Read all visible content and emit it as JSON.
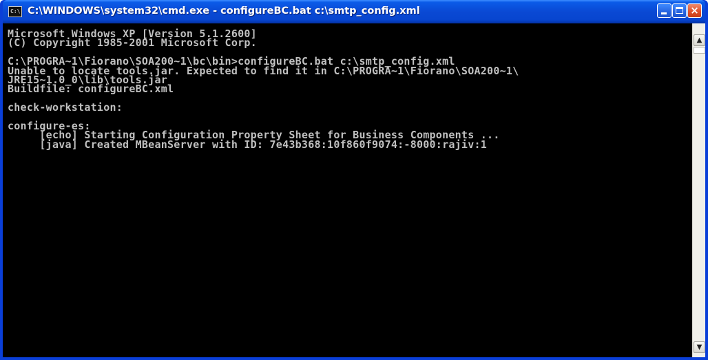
{
  "window": {
    "title": "C:\\WINDOWS\\system32\\cmd.exe - configureBC.bat c:\\smtp_config.xml",
    "icon_label": "C:\\",
    "icon": "cmd-console-icon"
  },
  "titlebar_buttons": {
    "minimize": "minimize-icon",
    "maximize": "maximize-icon",
    "close": "close-icon",
    "close_glyph": "×"
  },
  "colors": {
    "console_background": "#000000",
    "console_text": "#c0c0c0",
    "titlebar": "#0a49d4",
    "close_button": "#e0512b"
  },
  "console": {
    "lines": [
      "Microsoft Windows XP [Version 5.1.2600]",
      "(C) Copyright 1985-2001 Microsoft Corp.",
      "",
      "C:\\PROGRA~1\\Fiorano\\SOA200~1\\bc\\bin>configureBC.bat c:\\smtp_config.xml",
      "Unable to locate tools.jar. Expected to find it in C:\\PROGRA~1\\Fiorano\\SOA200~1\\",
      "JRE15~1.0_0\\lib\\tools.jar",
      "Buildfile: configureBC.xml",
      "",
      "check-workstation:",
      "",
      "configure-es:",
      "     [echo] Starting Configuration Property Sheet for Business Components ...",
      "     [java] Created MBeanServer with ID: 7e43b368:10f860f9074:-8000:rajiv:1"
    ]
  },
  "scrollbar": {
    "up_glyph": "▲",
    "down_glyph": "▼"
  }
}
